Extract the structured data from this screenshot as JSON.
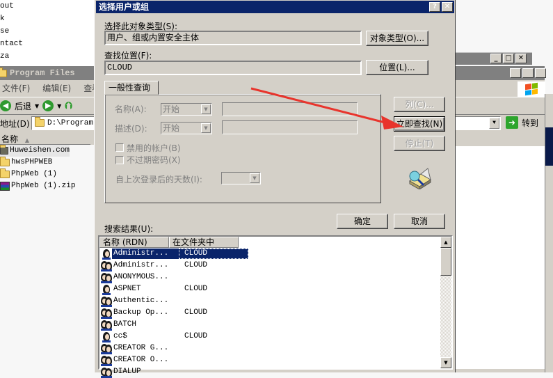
{
  "background_list": {
    "items": [
      "out",
      "k",
      "se",
      "ntact",
      "za"
    ]
  },
  "explorer": {
    "title": "Program Files",
    "menu": [
      "文件(F)",
      "编辑(E)",
      "查看"
    ],
    "toolbar": {
      "back_label": "后退",
      "back_icon": "back-arrow-icon",
      "forward_icon": "forward-arrow-icon",
      "up_icon": "folder-up-icon"
    },
    "address_label": "地址(D)",
    "address_value": "D:\\Program Files",
    "go_label": "转到",
    "column_name": "名称",
    "files": [
      {
        "name": "Huweishen.com",
        "icon": "folder-icon",
        "selected": true
      },
      {
        "name": "hwsPHPWEB",
        "icon": "folder-icon",
        "selected": false
      },
      {
        "name": "PhpWeb (1)",
        "icon": "folder-icon",
        "selected": false
      },
      {
        "name": "PhpWeb (1).zip",
        "icon": "winrar-archive-icon",
        "selected": false
      }
    ]
  },
  "dialog": {
    "title": "选择用户或组",
    "help_btn": "?",
    "close_btn": "✕",
    "object_type_label": "选择此对象类型(S):",
    "object_type_value": "用户、组或内置安全主体",
    "object_type_btn": "对象类型(O)...",
    "location_label": "查找位置(F):",
    "location_value": "CLOUD",
    "location_btn": "位置(L)...",
    "tab_label": "一般性查询",
    "name_label": "名称(A):",
    "name_combo": "开始",
    "desc_label": "描述(D):",
    "desc_combo": "开始",
    "disabled_accounts_label": "禁用的帐户(B)",
    "non_expiring_label": "不过期密码(X)",
    "days_label": "自上次登录后的天数(I):",
    "columns_btn": "列(C)...",
    "find_now_btn": "立即查找(N)",
    "stop_btn": "停止(T)",
    "ok_btn": "确定",
    "cancel_btn": "取消",
    "results_label": "搜索结果(U):",
    "results_headers": [
      "名称 (RDN)",
      "在文件夹中"
    ],
    "results": [
      {
        "name": "Administr...",
        "folder": "CLOUD",
        "type": "user",
        "selected": true
      },
      {
        "name": "Administr...",
        "folder": "CLOUD",
        "type": "group",
        "selected": false
      },
      {
        "name": "ANONYMOUS...",
        "folder": "",
        "type": "group",
        "selected": false
      },
      {
        "name": "ASPNET",
        "folder": "CLOUD",
        "type": "user",
        "selected": false
      },
      {
        "name": "Authentic...",
        "folder": "",
        "type": "group",
        "selected": false
      },
      {
        "name": "Backup Op...",
        "folder": "CLOUD",
        "type": "group",
        "selected": false
      },
      {
        "name": "BATCH",
        "folder": "",
        "type": "group",
        "selected": false
      },
      {
        "name": "cc$",
        "folder": "CLOUD",
        "type": "user",
        "selected": false
      },
      {
        "name": "CREATOR G...",
        "folder": "",
        "type": "group",
        "selected": false
      },
      {
        "name": "CREATOR O...",
        "folder": "",
        "type": "group",
        "selected": false
      },
      {
        "name": "DIALUP",
        "folder": "",
        "type": "group",
        "selected": false
      }
    ]
  },
  "annotation": {
    "type": "red-arrow",
    "points_to": "find-now-button",
    "color": "#e8342c"
  },
  "colors": {
    "titlebar_active": "#0a246a",
    "titlebar_inactive": "#808080",
    "face": "#d4d0c8",
    "selection": "#0a246a"
  }
}
